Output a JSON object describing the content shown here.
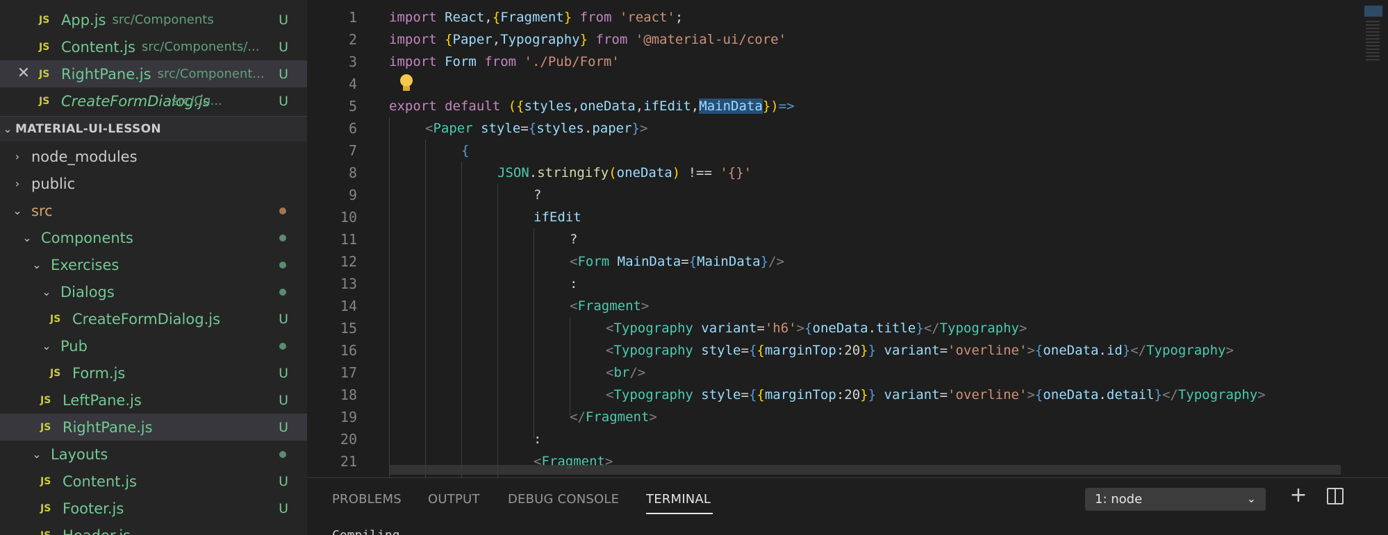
{
  "open_editors": [
    {
      "name": "App.js",
      "path": "src/Components",
      "status": "U",
      "italic": false,
      "selected": false,
      "close": false
    },
    {
      "name": "Content.js",
      "path": "src/Components/...",
      "status": "U",
      "italic": false,
      "selected": false,
      "close": false
    },
    {
      "name": "RightPane.js",
      "path": "src/Component...",
      "status": "U",
      "italic": false,
      "selected": true,
      "close": true
    },
    {
      "name": "CreateFormDialog.js",
      "path": "src/Co...",
      "status": "U",
      "italic": true,
      "selected": false,
      "close": false
    }
  ],
  "explorer": {
    "section_title": "MATERIAL-UI-LESSON",
    "items": [
      {
        "label": "node_modules"
      },
      {
        "label": "public"
      },
      {
        "label": "src"
      },
      {
        "label": "Components"
      },
      {
        "label": "Exercises"
      },
      {
        "label": "Dialogs"
      },
      {
        "label": "CreateFormDialog.js",
        "status": "U"
      },
      {
        "label": "Pub"
      },
      {
        "label": "Form.js",
        "status": "U"
      },
      {
        "label": "LeftPane.js",
        "status": "U"
      },
      {
        "label": "RightPane.js",
        "status": "U"
      },
      {
        "label": "Layouts"
      },
      {
        "label": "Content.js",
        "status": "U"
      },
      {
        "label": "Footer.js",
        "status": "U"
      },
      {
        "label": "Header.js"
      }
    ]
  },
  "js_badge": "JS",
  "editor": {
    "line_numbers": [
      "1",
      "2",
      "3",
      "4",
      "5",
      "6",
      "7",
      "8",
      "9",
      "10",
      "11",
      "12",
      "13",
      "14",
      "15",
      "16",
      "17",
      "18",
      "19",
      "20",
      "21"
    ]
  },
  "panel": {
    "tabs": [
      "PROBLEMS",
      "OUTPUT",
      "DEBUG CONSOLE",
      "TERMINAL"
    ],
    "active_tab": "TERMINAL",
    "terminal_select": "1: node",
    "terminal_output": "Compiling..."
  },
  "colors": {
    "accent_modified": "#73c991",
    "highlight": "#264f78",
    "background": "#1e1e1e"
  }
}
